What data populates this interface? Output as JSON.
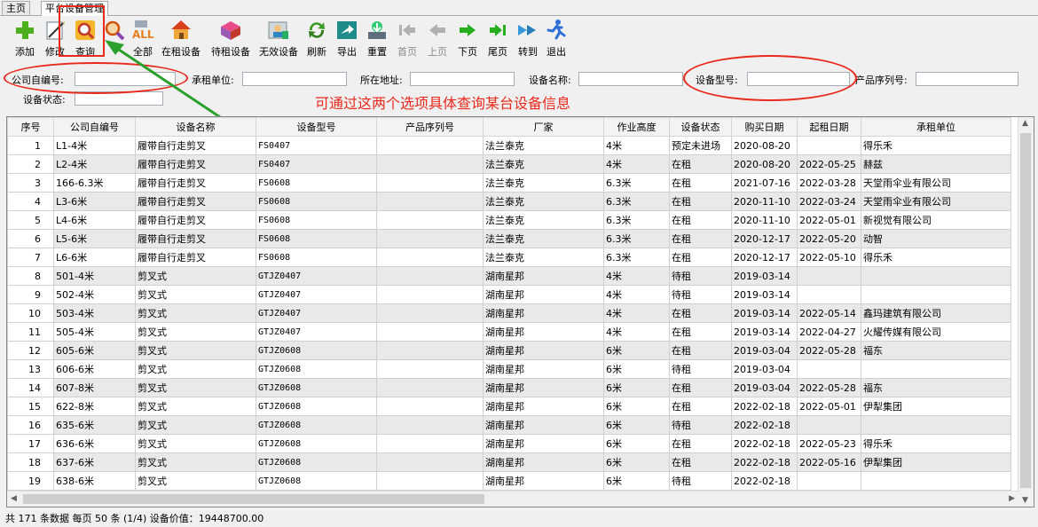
{
  "tabs": [
    "主页",
    "平台设备管理"
  ],
  "toolbar": [
    {
      "label": "添加",
      "icon": "plus-icon",
      "enabled": true
    },
    {
      "label": "修改",
      "icon": "edit-icon",
      "enabled": true
    },
    {
      "label": "查询",
      "icon": "search-icon",
      "enabled": true
    },
    {
      "label": "",
      "icon": "magnifier-icon",
      "enabled": true
    },
    {
      "label": "全部",
      "icon": "all-icon",
      "enabled": true
    },
    {
      "label": "在租设备",
      "icon": "house-icon",
      "enabled": true
    },
    {
      "label": "待租设备",
      "icon": "box-icon",
      "enabled": true
    },
    {
      "label": "无效设备",
      "icon": "person-icon",
      "enabled": true
    },
    {
      "label": "刷新",
      "icon": "refresh-icon",
      "enabled": true
    },
    {
      "label": "导出",
      "icon": "export-icon",
      "enabled": true
    },
    {
      "label": "重置",
      "icon": "reset-icon",
      "enabled": true
    },
    {
      "label": "首页",
      "icon": "first-page-icon",
      "enabled": false
    },
    {
      "label": "上页",
      "icon": "prev-page-icon",
      "enabled": false
    },
    {
      "label": "下页",
      "icon": "next-page-icon",
      "enabled": true
    },
    {
      "label": "尾页",
      "icon": "last-page-icon",
      "enabled": true
    },
    {
      "label": "转到",
      "icon": "goto-icon",
      "enabled": true
    },
    {
      "label": "退出",
      "icon": "exit-icon",
      "enabled": true
    }
  ],
  "search": {
    "company_code": "公司自编号:",
    "renter": "承租单位:",
    "address": "所在地址:",
    "device_name": "设备名称:",
    "device_model": "设备型号:",
    "serial": "产品序列号:",
    "status": "设备状态:"
  },
  "annotation": "可通过这两个选项具体查询某台设备信息",
  "grid": {
    "columns": [
      "序号",
      "公司自编号",
      "设备名称",
      "设备型号",
      "产品序列号",
      "厂家",
      "作业高度",
      "设备状态",
      "购买日期",
      "起租日期",
      "承租单位"
    ],
    "rows": [
      [
        "1",
        "L1-4米",
        "履带自行走剪叉",
        "FS0407",
        "",
        "法兰泰克",
        "4米",
        "预定未进场",
        "2020-08-20",
        "",
        "得乐禾"
      ],
      [
        "2",
        "L2-4米",
        "履带自行走剪叉",
        "FS0407",
        "",
        "法兰泰克",
        "4米",
        "在租",
        "2020-08-20",
        "2022-05-25",
        "赫兹"
      ],
      [
        "3",
        "166-6.3米",
        "履带自行走剪叉",
        "FS0608",
        "",
        "法兰泰克",
        "6.3米",
        "在租",
        "2021-07-16",
        "2022-03-28",
        "天堂雨伞业有限公司"
      ],
      [
        "4",
        "L3-6米",
        "履带自行走剪叉",
        "FS0608",
        "",
        "法兰泰克",
        "6.3米",
        "在租",
        "2020-11-10",
        "2022-03-24",
        "天堂雨伞业有限公司"
      ],
      [
        "5",
        "L4-6米",
        "履带自行走剪叉",
        "FS0608",
        "",
        "法兰泰克",
        "6.3米",
        "在租",
        "2020-11-10",
        "2022-05-01",
        "新视觉有限公司"
      ],
      [
        "6",
        "L5-6米",
        "履带自行走剪叉",
        "FS0608",
        "",
        "法兰泰克",
        "6.3米",
        "在租",
        "2020-12-17",
        "2022-05-20",
        "动智"
      ],
      [
        "7",
        "L6-6米",
        "履带自行走剪叉",
        "FS0608",
        "",
        "法兰泰克",
        "6.3米",
        "在租",
        "2020-12-17",
        "2022-05-10",
        "得乐禾"
      ],
      [
        "8",
        "501-4米",
        "剪叉式",
        "GTJZ0407",
        "",
        "湖南星邦",
        "4米",
        "待租",
        "2019-03-14",
        "",
        ""
      ],
      [
        "9",
        "502-4米",
        "剪叉式",
        "GTJZ0407",
        "",
        "湖南星邦",
        "4米",
        "待租",
        "2019-03-14",
        "",
        ""
      ],
      [
        "10",
        "503-4米",
        "剪叉式",
        "GTJZ0407",
        "",
        "湖南星邦",
        "4米",
        "在租",
        "2019-03-14",
        "2022-05-14",
        "鑫玛建筑有限公司"
      ],
      [
        "11",
        "505-4米",
        "剪叉式",
        "GTJZ0407",
        "",
        "湖南星邦",
        "4米",
        "在租",
        "2019-03-14",
        "2022-04-27",
        "火耀传媒有限公司"
      ],
      [
        "12",
        "605-6米",
        "剪叉式",
        "GTJZ0608",
        "",
        "湖南星邦",
        "6米",
        "在租",
        "2019-03-04",
        "2022-05-28",
        "福东"
      ],
      [
        "13",
        "606-6米",
        "剪叉式",
        "GTJZ0608",
        "",
        "湖南星邦",
        "6米",
        "待租",
        "2019-03-04",
        "",
        ""
      ],
      [
        "14",
        "607-8米",
        "剪叉式",
        "GTJZ0608",
        "",
        "湖南星邦",
        "6米",
        "在租",
        "2019-03-04",
        "2022-05-28",
        "福东"
      ],
      [
        "15",
        "622-8米",
        "剪叉式",
        "GTJZ0608",
        "",
        "湖南星邦",
        "6米",
        "在租",
        "2022-02-18",
        "2022-05-01",
        "伊犁集团"
      ],
      [
        "16",
        "635-6米",
        "剪叉式",
        "GTJZ0608",
        "",
        "湖南星邦",
        "6米",
        "待租",
        "2022-02-18",
        "",
        ""
      ],
      [
        "17",
        "636-6米",
        "剪叉式",
        "GTJZ0608",
        "",
        "湖南星邦",
        "6米",
        "在租",
        "2022-02-18",
        "2022-05-23",
        "得乐禾"
      ],
      [
        "18",
        "637-6米",
        "剪叉式",
        "GTJZ0608",
        "",
        "湖南星邦",
        "6米",
        "在租",
        "2022-02-18",
        "2022-05-16",
        "伊犁集团"
      ],
      [
        "19",
        "638-6米",
        "剪叉式",
        "GTJZ0608",
        "",
        "湖南星邦",
        "6米",
        "待租",
        "2022-02-18",
        "",
        ""
      ]
    ]
  },
  "status_bar": "共 171 条数据  每页 50 条 (1/4)   设备价值：19448700.00",
  "colors": {
    "annotation": "#e8291c",
    "arrow": "#2ca02c"
  }
}
